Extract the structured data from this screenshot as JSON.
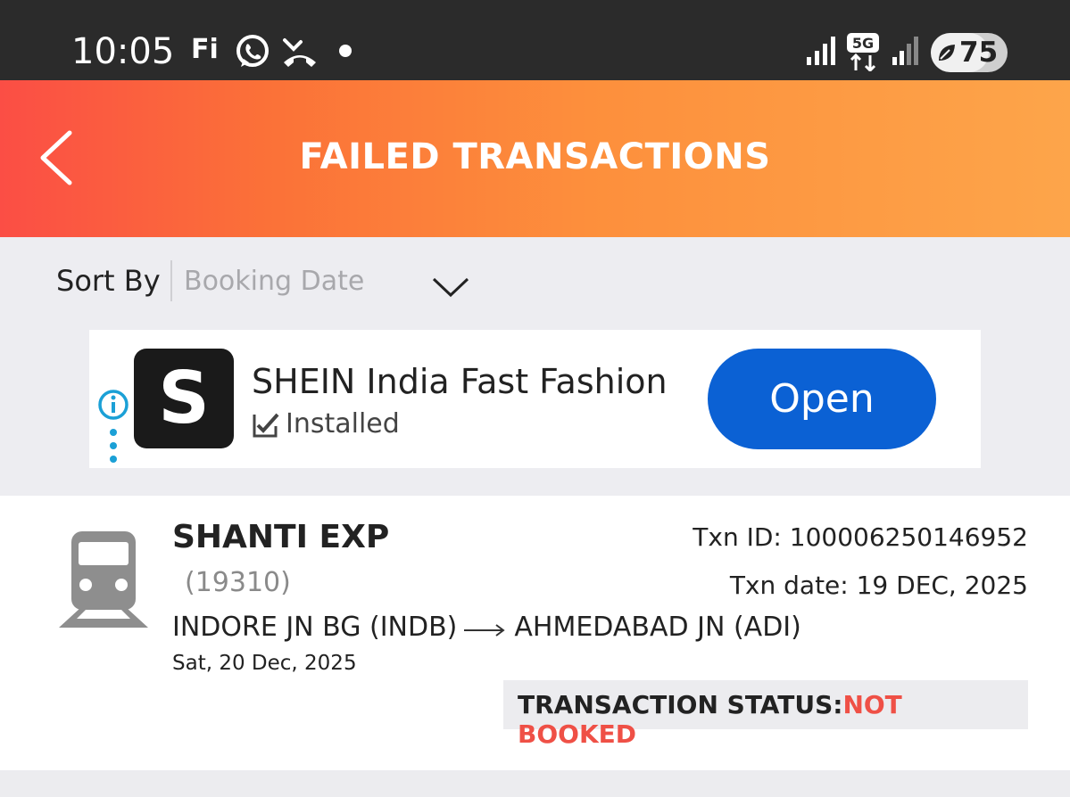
{
  "status_bar": {
    "time": "10:05",
    "notification_icons": [
      "fi-icon",
      "whatsapp-icon",
      "missed-call-icon",
      "dot-icon"
    ],
    "network": "5G",
    "battery": "75",
    "battery_level_percent": 75
  },
  "header": {
    "title": "FAILED TRANSACTIONS",
    "back_icon": "chevron-left-icon",
    "gradient_colors": [
      "#fb4e45",
      "#fda54a"
    ]
  },
  "sort": {
    "label": "Sort By",
    "value": "Booking Date"
  },
  "ad": {
    "app_initial": "S",
    "app_name": "SHEIN India Fast Fashion",
    "installed_label": "Installed",
    "open_label": "Open",
    "button_color": "#0b61d4"
  },
  "transaction": {
    "train_name": "SHANTI EXP",
    "train_number": "(19310)",
    "from": "INDORE JN BG (INDB)",
    "to": "AHMEDABAD JN (ADI)",
    "journey_date": "Sat, 20 Dec, 2025",
    "txn_id": "Txn ID: 100006250146952",
    "txn_date": "Txn date: 19 DEC, 2025",
    "status_label": "TRANSACTION STATUS:",
    "status_value": "NOT BOOKED",
    "status_color": "#ef5046"
  }
}
